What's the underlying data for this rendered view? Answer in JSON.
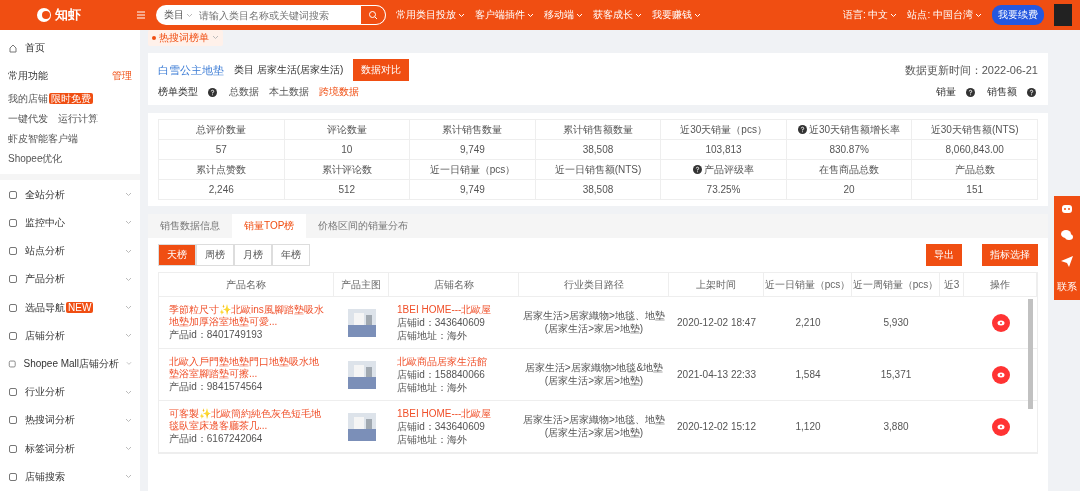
{
  "topbar": {
    "logo": "知虾",
    "search": {
      "category": "类目",
      "placeholder": "请输入类目名称或关键词搜索"
    },
    "nav": [
      "常用类目投放",
      "客户端插件",
      "移动端",
      "获客成长",
      "我要赚钱"
    ],
    "language": "语言: 中文",
    "site": "站点: 中国台湾",
    "renew": "我要续费"
  },
  "tag_bar": {
    "tags": [
      {
        "label": "热搜词榜单",
        "selected": true
      }
    ]
  },
  "sidebar": {
    "home": "首页",
    "common_title": "常用功能",
    "manage": "管理",
    "common_items": [
      {
        "label": "我的店铺",
        "badge": "限时免费"
      },
      {
        "label": "一键代发"
      },
      {
        "label": "运行计算"
      },
      {
        "label": "虾皮智能客户端"
      },
      {
        "label": "Shopee优化"
      }
    ],
    "menu": [
      {
        "label": "全站分析"
      },
      {
        "label": "监控中心"
      },
      {
        "label": "站点分析"
      },
      {
        "label": "产品分析"
      },
      {
        "label": "选品导航",
        "badge": "NEW"
      },
      {
        "label": "店铺分析"
      },
      {
        "label": "Shopee Mall店铺分析"
      },
      {
        "label": "行业分析"
      },
      {
        "label": "热搜词分析"
      },
      {
        "label": "标签词分析"
      },
      {
        "label": "店铺搜索"
      }
    ]
  },
  "header": {
    "keyword": "白雪公主地垫",
    "category": "类目  居家生活(居家生活)",
    "compare": "数据对比",
    "updated": "数据更新时间：2022-06-21",
    "list_type": "榜单类型",
    "sources": [
      {
        "label": "总数据",
        "selected": false
      },
      {
        "label": "本土数据",
        "selected": false
      },
      {
        "label": "跨境数据",
        "selected": true
      }
    ],
    "sorts": [
      "销量",
      "销售额"
    ]
  },
  "stats": [
    [
      {
        "label": "总评价数量",
        "value": "57"
      },
      {
        "label": "评论数量",
        "value": "10"
      },
      {
        "label": "累计销售数量",
        "value": "9,749"
      },
      {
        "label": "累计销售额数量",
        "value": "38,508"
      },
      {
        "label": "近30天销量（pcs）",
        "value": "103,813"
      },
      {
        "label": "近30天销售额增长率",
        "value": "830.87%",
        "help": true
      },
      {
        "label": "近30天销售额(NTS)",
        "value": "8,060,843.00"
      }
    ],
    [
      {
        "label": "累计点赞数",
        "value": "2,246"
      },
      {
        "label": "累计评论数",
        "value": "512"
      },
      {
        "label": "近一日销量（pcs）",
        "value": "9,749"
      },
      {
        "label": "近一日销售额(NTS)",
        "value": "38,508"
      },
      {
        "label": "产品评级率",
        "value": "73.25%",
        "help": true
      },
      {
        "label": "在售商品总数",
        "value": "20"
      },
      {
        "label": "产品总数",
        "value": "151"
      }
    ]
  ],
  "tabs": [
    {
      "label": "销售数据信息",
      "selected": false
    },
    {
      "label": "销量TOP榜",
      "selected": true
    },
    {
      "label": "价格区间的销量分布",
      "selected": false
    }
  ],
  "periods": [
    {
      "label": "天榜",
      "selected": true
    },
    {
      "label": "周榜",
      "selected": false
    },
    {
      "label": "月榜",
      "selected": false
    },
    {
      "label": "年榜",
      "selected": false
    }
  ],
  "actions": [
    "导出",
    "指标选择"
  ],
  "table": {
    "columns": [
      "产品名称",
      "产品主图",
      "店铺名称",
      "行业类目路径",
      "上架时间",
      "近一日销量（pcs）",
      "近一周销量（pcs）",
      "近3",
      "操作"
    ],
    "rows": [
      {
        "name": "季節粒尺寸✨北歐ins風腳踏墊吸水地墊加厚浴室地墊可愛...",
        "product_id": "产品id：8401749193",
        "shop": "1BEI HOME---北歐屋",
        "shop_id": "店铺id：343640609",
        "address": "店铺地址：海外",
        "path": "居家生活>居家織物>地毯、地墊",
        "path_sub": "(居家生活>家居>地墊)",
        "time": "2020-12-02 18:47",
        "day": "2,210",
        "week": "5,930"
      },
      {
        "name": "北歐入戶門墊地墊門口地墊吸水地墊浴室腳踏墊可擦...",
        "product_id": "产品id：9841574564",
        "shop": "北歐商品居家生活館",
        "shop_id": "店铺id：158840066",
        "address": "店铺地址：海外",
        "path": "居家生活>居家織物>地毯&地墊",
        "path_sub": "(居家生活>家居>地墊)",
        "time": "2021-04-13 22:33",
        "day": "1,584",
        "week": "15,371"
      },
      {
        "name": "可客製✨北歐簡約純色灰色短毛地毯臥室床邊客廳茶几...",
        "product_id": "产品id：6167242064",
        "shop": "1BEI HOME---北歐屋",
        "shop_id": "店铺id：343640609",
        "address": "店铺地址：海外",
        "path": "居家生活>居家織物>地毯、地墊",
        "path_sub": "(居家生活>家居>地墊)",
        "time": "2020-12-02 15:12",
        "day": "1,120",
        "week": "3,880"
      }
    ]
  },
  "float_bar": {
    "label": "联系"
  }
}
